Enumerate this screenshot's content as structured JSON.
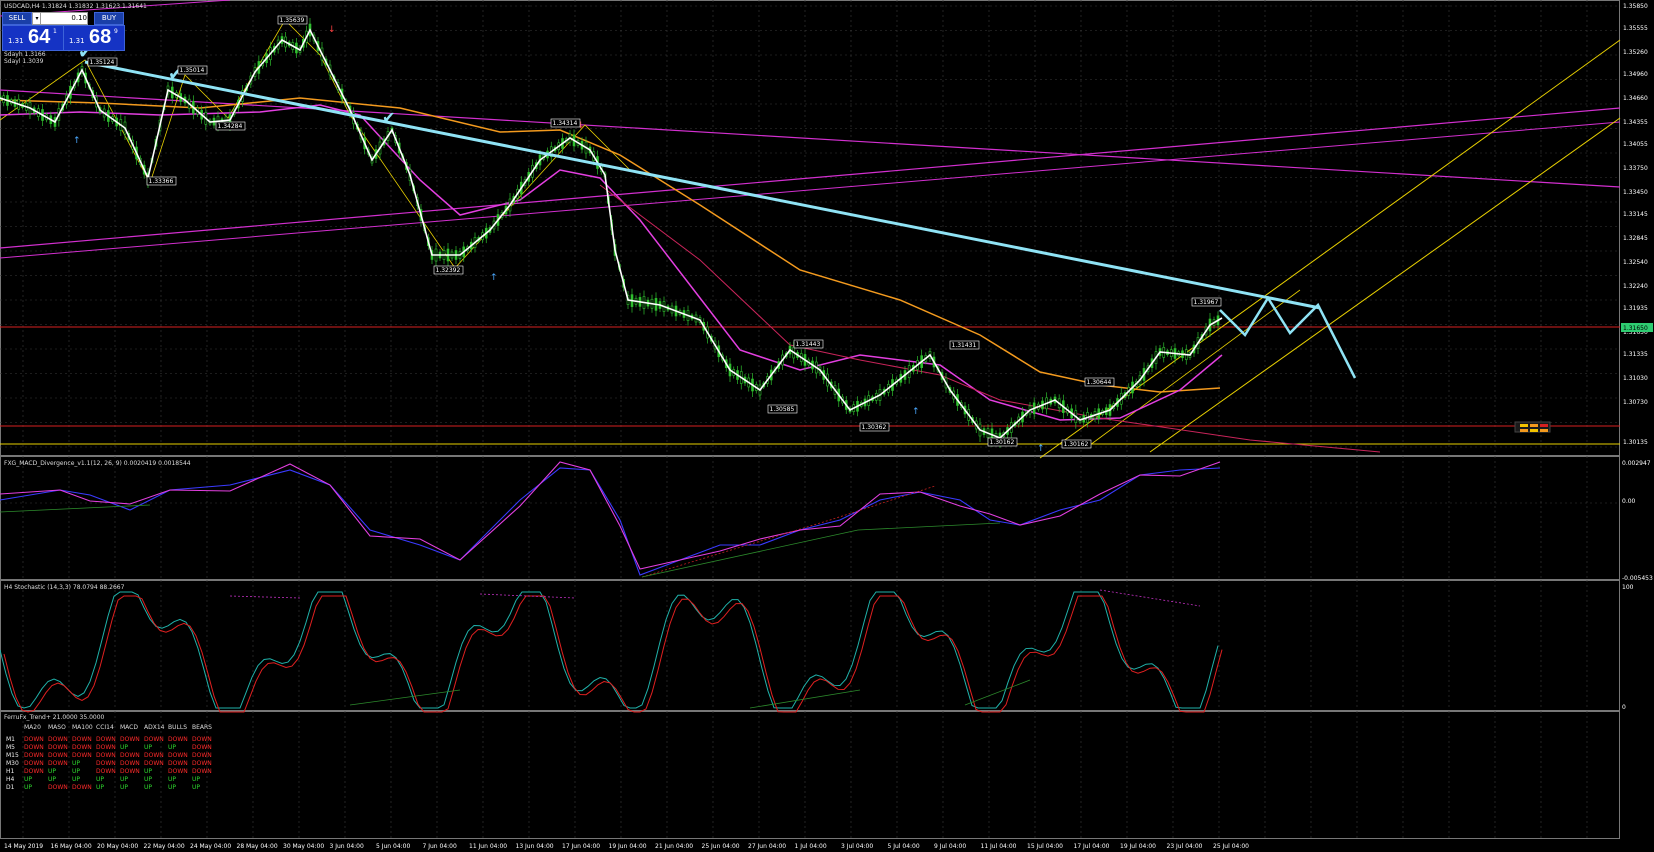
{
  "symbol_header": "USDCAD,H4  1.31824 1.31832 1.31623 1.31641",
  "trade_panel": {
    "sell_label": "SELL",
    "buy_label": "BUY",
    "lot": "0.10",
    "sell_price_prefix": "1.31",
    "sell_price_big": "64",
    "sell_price_sup": "1",
    "buy_price_prefix": "1.31",
    "buy_price_big": "68",
    "buy_price_sup": "9"
  },
  "info_lines": [
    "Sdayh 1.3166",
    "Sdayl 1.3039"
  ],
  "colors": {
    "background": "#000000",
    "grid": "#3a3a3a",
    "trendline_main": "#8fe3f5",
    "channel": "#ffd400",
    "magenta": "#e33fe0",
    "orange": "#f39a1e",
    "price_line": "#ffffff",
    "candle": "#33cc33",
    "current_price_bg": "#2ecc71"
  },
  "price_axis": [
    "1.35850",
    "1.35555",
    "1.35260",
    "1.34960",
    "1.34660",
    "1.34355",
    "1.34055",
    "1.33750",
    "1.33450",
    "1.33145",
    "1.32845",
    "1.32540",
    "1.32240",
    "1.31935",
    "1.31650",
    "1.31335",
    "1.31030",
    "1.30730",
    "1.30135"
  ],
  "current_price_tag": "1.31650",
  "time_axis": [
    "14 May 2019",
    "16 May 04:00",
    "20 May 04:00",
    "22 May 04:00",
    "24 May 04:00",
    "28 May 04:00",
    "30 May 04:00",
    "3 Jun 04:00",
    "5 Jun 04:00",
    "7 Jun 04:00",
    "11 Jun 04:00",
    "13 Jun 04:00",
    "17 Jun 04:00",
    "19 Jun 04:00",
    "21 Jun 04:00",
    "25 Jun 04:00",
    "27 Jun 04:00",
    "1 Jul 04:00",
    "3 Jul 04:00",
    "5 Jul 04:00",
    "9 Jul 04:00",
    "11 Jul 04:00",
    "15 Jul 04:00",
    "17 Jul 04:00",
    "19 Jul 04:00",
    "23 Jul 04:00",
    "25 Jul 04:00"
  ],
  "swing_labels": [
    {
      "text": "1.35639"
    },
    {
      "text": "1.35124"
    },
    {
      "text": "1.35014"
    },
    {
      "text": "1.34284"
    },
    {
      "text": "1.33366"
    },
    {
      "text": "1.32392"
    },
    {
      "text": "1.34314"
    },
    {
      "text": "1.31443"
    },
    {
      "text": "1.30585"
    },
    {
      "text": "1.30362"
    },
    {
      "text": "1.31431"
    },
    {
      "text": "1.30644"
    },
    {
      "text": "1.30162"
    },
    {
      "text": "1.30162"
    },
    {
      "text": "1.31967"
    }
  ],
  "macd_panel": {
    "title": "FXG_MACD_Divergence_v1.1(12, 26, 9) 0.0020419 0.0018544",
    "axis": [
      "0.002947",
      "0.00",
      "-0.005453"
    ]
  },
  "stoch_panel": {
    "title": "H4  Stochastic (14,3,3) 78.0794 88.2667",
    "axis": [
      "100",
      "0"
    ]
  },
  "trend_panel": {
    "title": "FerruFx_Trend+ 21.0000 35.0000",
    "headers": [
      "MA20",
      "MASO",
      "MA100",
      "CCI14",
      "MACD",
      "ADX14",
      "BULLS",
      "BEARS"
    ],
    "rows": [
      {
        "tf": "M1",
        "cells": [
          "DOWN",
          "DOWN",
          "DOWN",
          "DOWN",
          "DOWN",
          "DOWN",
          "DOWN",
          "DOWN"
        ]
      },
      {
        "tf": "M5",
        "cells": [
          "DOWN",
          "DOWN",
          "DOWN",
          "DOWN",
          "UP",
          "UP",
          "UP",
          "DOWN"
        ]
      },
      {
        "tf": "M15",
        "cells": [
          "DOWN",
          "DOWN",
          "DOWN",
          "DOWN",
          "DOWN",
          "DOWN",
          "DOWN",
          "DOWN"
        ]
      },
      {
        "tf": "M30",
        "cells": [
          "DOWN",
          "DOWN",
          "UP",
          "DOWN",
          "DOWN",
          "DOWN",
          "DOWN",
          "DOWN"
        ]
      },
      {
        "tf": "H1",
        "cells": [
          "DOWN",
          "UP",
          "UP",
          "DOWN",
          "DOWN",
          "UP",
          "DOWN",
          "DOWN"
        ]
      },
      {
        "tf": "H4",
        "cells": [
          "UP",
          "UP",
          "UP",
          "UP",
          "UP",
          "UP",
          "UP",
          "UP"
        ]
      },
      {
        "tf": "D1",
        "cells": [
          "UP",
          "DOWN",
          "DOWN",
          "UP",
          "UP",
          "UP",
          "UP",
          "UP"
        ]
      }
    ]
  }
}
